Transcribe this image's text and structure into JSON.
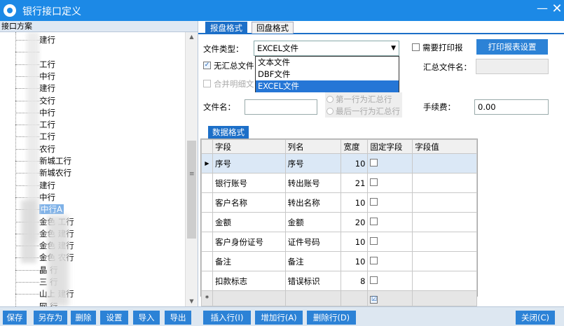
{
  "window": {
    "title": "银行接口定义",
    "minimize": "—",
    "close": "✕"
  },
  "left": {
    "header": "接口方案",
    "tree": [
      "建行",
      "",
      "工行",
      "中行",
      "建行",
      "交行",
      "中行",
      "工行",
      "工行",
      "农行",
      "新城工行",
      "新城农行",
      "建行",
      "中行",
      "中行A",
      "金色 工行",
      "金色 建行",
      "金色 建行",
      "金色 农行",
      "晶 行",
      "三 行",
      "山上 建行",
      "网 行"
    ],
    "selected_index": 14,
    "scroll": {
      "up": "▲",
      "down": "▼",
      "grip": "≡"
    }
  },
  "tabs": [
    "报盘格式",
    "回盘格式"
  ],
  "form": {
    "file_type_label": "文件类型：",
    "file_type_value": "EXCEL文件",
    "file_type_options": [
      "文本文件",
      "DBF文件",
      "EXCEL文件"
    ],
    "need_print_label": "需要打印报",
    "print_setup_button": "打印报表设置",
    "no_summary_label": "无汇总文件",
    "summary_file_label": "汇总文件名：",
    "merge_detail_label": "合并明细文",
    "radio_first": "第一行为汇总行",
    "radio_last": "最后一行为汇总行",
    "filename_label": "文件名：",
    "fee_label": "手续费：",
    "fee_value": "0.00"
  },
  "data_format": {
    "tab_label": "数据格式",
    "columns": [
      "字段",
      "列名",
      "宽度",
      "固定字段",
      "字段值"
    ],
    "rows": [
      {
        "field": "序号",
        "column": "序号",
        "width": "10"
      },
      {
        "field": "银行账号",
        "column": "转出账号",
        "width": "21"
      },
      {
        "field": "客户名称",
        "column": "转出名称",
        "width": "10"
      },
      {
        "field": "金额",
        "column": "金额",
        "width": "20"
      },
      {
        "field": "客户身份证号",
        "column": "证件号码",
        "width": "10"
      },
      {
        "field": "备注",
        "column": "备注",
        "width": "10"
      },
      {
        "field": "扣款标志",
        "column": "错误标识",
        "width": "8"
      }
    ],
    "current_marker": "▶",
    "new_row_marker": "*"
  },
  "buttons": {
    "save": "保存",
    "save_as": "另存为",
    "delete": "删除",
    "settings": "设置",
    "import": "导入",
    "export": "导出",
    "insert_row": "插入行(I)",
    "add_row": "增加行(A)",
    "delete_row": "删除行(D)",
    "close": "关闭(C)"
  }
}
